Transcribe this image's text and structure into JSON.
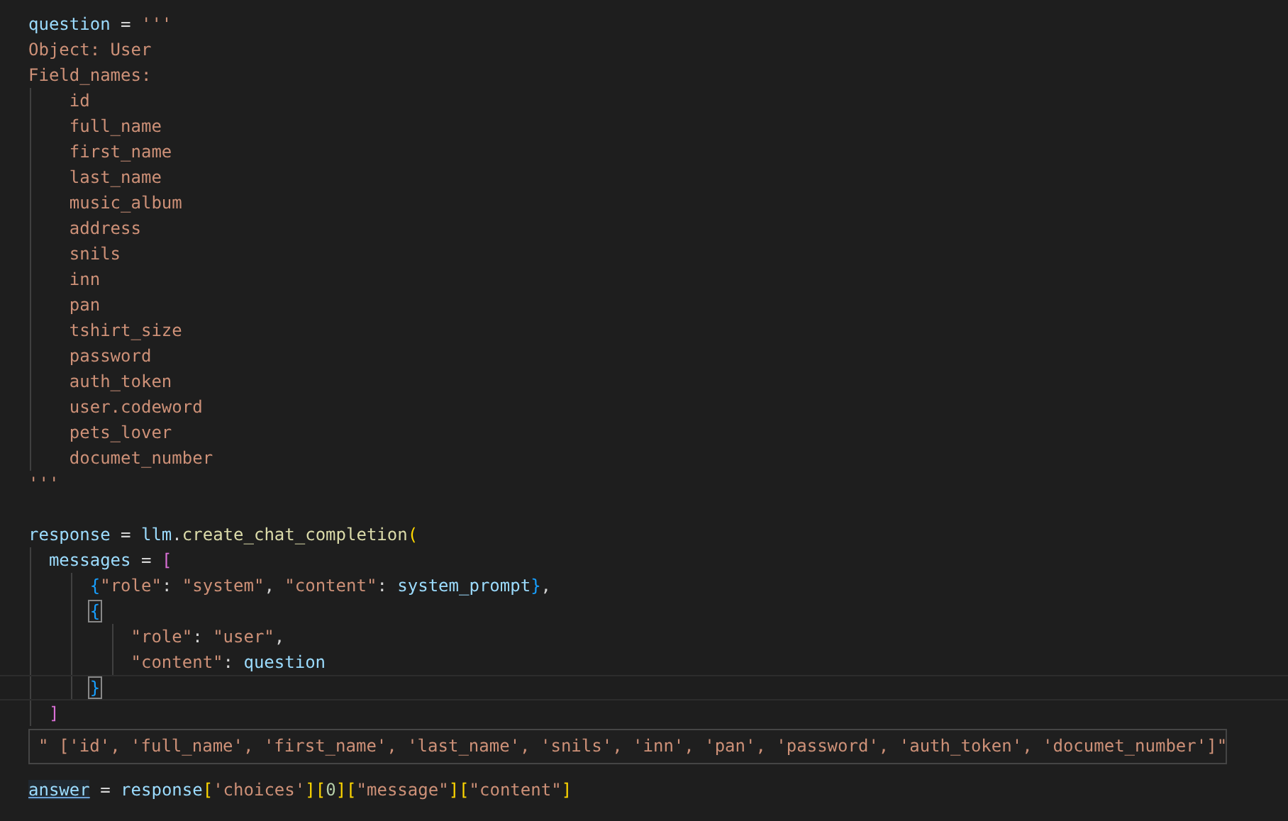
{
  "editor": {
    "lines": [
      {
        "kind": "code",
        "tokens": [
          {
            "text": "question",
            "kind": "var"
          },
          {
            "text": " = ",
            "kind": "op"
          },
          {
            "text": "'''",
            "kind": "str"
          }
        ]
      },
      {
        "kind": "code",
        "tokens": [
          {
            "text": "Object: User",
            "kind": "str"
          }
        ]
      },
      {
        "kind": "code",
        "tokens": [
          {
            "text": "Field_names:",
            "kind": "str"
          }
        ]
      },
      {
        "kind": "code",
        "tokens": [
          {
            "text": "    id",
            "kind": "str"
          }
        ]
      },
      {
        "kind": "code",
        "tokens": [
          {
            "text": "    full_name",
            "kind": "str"
          }
        ]
      },
      {
        "kind": "code",
        "tokens": [
          {
            "text": "    first_name",
            "kind": "str"
          }
        ]
      },
      {
        "kind": "code",
        "tokens": [
          {
            "text": "    last_name",
            "kind": "str"
          }
        ]
      },
      {
        "kind": "code",
        "tokens": [
          {
            "text": "    music_album",
            "kind": "str"
          }
        ]
      },
      {
        "kind": "code",
        "tokens": [
          {
            "text": "    address",
            "kind": "str"
          }
        ]
      },
      {
        "kind": "code",
        "tokens": [
          {
            "text": "    snils",
            "kind": "str"
          }
        ]
      },
      {
        "kind": "code",
        "tokens": [
          {
            "text": "    inn",
            "kind": "str"
          }
        ]
      },
      {
        "kind": "code",
        "tokens": [
          {
            "text": "    pan",
            "kind": "str"
          }
        ]
      },
      {
        "kind": "code",
        "tokens": [
          {
            "text": "    tshirt_size",
            "kind": "str"
          }
        ]
      },
      {
        "kind": "code",
        "tokens": [
          {
            "text": "    password",
            "kind": "str"
          }
        ]
      },
      {
        "kind": "code",
        "tokens": [
          {
            "text": "    auth_token",
            "kind": "str"
          }
        ]
      },
      {
        "kind": "code",
        "tokens": [
          {
            "text": "    user.codeword",
            "kind": "str"
          }
        ]
      },
      {
        "kind": "code",
        "tokens": [
          {
            "text": "    pets_lover",
            "kind": "str"
          }
        ]
      },
      {
        "kind": "code",
        "tokens": [
          {
            "text": "    documet_number",
            "kind": "str"
          }
        ]
      },
      {
        "kind": "code",
        "tokens": [
          {
            "text": "'''",
            "kind": "str"
          }
        ]
      },
      {
        "kind": "blank"
      },
      {
        "kind": "code",
        "tokens": [
          {
            "text": "response",
            "kind": "var"
          },
          {
            "text": " = ",
            "kind": "op"
          },
          {
            "text": "llm",
            "kind": "var"
          },
          {
            "text": ".",
            "kind": "op"
          },
          {
            "text": "create_chat_completion",
            "kind": "fn"
          },
          {
            "text": "(",
            "kind": "bracket1"
          }
        ]
      },
      {
        "kind": "code",
        "tokens": [
          {
            "text": "  messages",
            "kind": "var"
          },
          {
            "text": " = ",
            "kind": "op"
          },
          {
            "text": "[",
            "kind": "bracket2"
          }
        ]
      },
      {
        "kind": "code",
        "tokens": [
          {
            "text": "      {",
            "kind": "bracket3"
          },
          {
            "text": "\"role\"",
            "kind": "str"
          },
          {
            "text": ": ",
            "kind": "op"
          },
          {
            "text": "\"system\"",
            "kind": "str"
          },
          {
            "text": ", ",
            "kind": "op"
          },
          {
            "text": "\"content\"",
            "kind": "str"
          },
          {
            "text": ": ",
            "kind": "op"
          },
          {
            "text": "system_prompt",
            "kind": "var"
          },
          {
            "text": "}",
            "kind": "bracket3"
          },
          {
            "text": ",",
            "kind": "op"
          }
        ]
      },
      {
        "kind": "code",
        "tokens": [
          {
            "text": "      {",
            "kind": "bracket3",
            "matched": true
          }
        ]
      },
      {
        "kind": "code",
        "tokens": [
          {
            "text": "          \"role\"",
            "kind": "str"
          },
          {
            "text": ": ",
            "kind": "op"
          },
          {
            "text": "\"user\"",
            "kind": "str"
          },
          {
            "text": ",",
            "kind": "op"
          }
        ]
      },
      {
        "kind": "code",
        "tokens": [
          {
            "text": "          \"content\"",
            "kind": "str"
          },
          {
            "text": ": ",
            "kind": "op"
          },
          {
            "text": "question",
            "kind": "var"
          }
        ]
      },
      {
        "kind": "code",
        "current": true,
        "tokens": [
          {
            "text": "      }",
            "kind": "bracket3",
            "matched": true
          }
        ]
      },
      {
        "kind": "code",
        "tokens": [
          {
            "text": "  ]",
            "kind": "bracket2"
          }
        ]
      },
      {
        "kind": "blank"
      },
      {
        "kind": "blank"
      },
      {
        "kind": "code",
        "tokens": [
          {
            "text": "answer",
            "kind": "link"
          },
          {
            "text": " = ",
            "kind": "op"
          },
          {
            "text": "response",
            "kind": "var"
          },
          {
            "text": "[",
            "kind": "bracket1"
          },
          {
            "text": "'choices'",
            "kind": "str"
          },
          {
            "text": "]",
            "kind": "bracket1"
          },
          {
            "text": "[",
            "kind": "bracket1"
          },
          {
            "text": "0",
            "kind": "num"
          },
          {
            "text": "]",
            "kind": "bracket1"
          },
          {
            "text": "[",
            "kind": "bracket1"
          },
          {
            "text": "\"message\"",
            "kind": "str"
          },
          {
            "text": "]",
            "kind": "bracket1"
          },
          {
            "text": "[",
            "kind": "bracket1"
          },
          {
            "text": "\"content\"",
            "kind": "str"
          },
          {
            "text": "]",
            "kind": "bracket1"
          }
        ]
      }
    ]
  },
  "hover": {
    "text": "\" ['id', 'full_name', 'first_name', 'last_name', 'snils', 'inn', 'pan', 'password', 'auth_token', 'documet_number']\""
  }
}
